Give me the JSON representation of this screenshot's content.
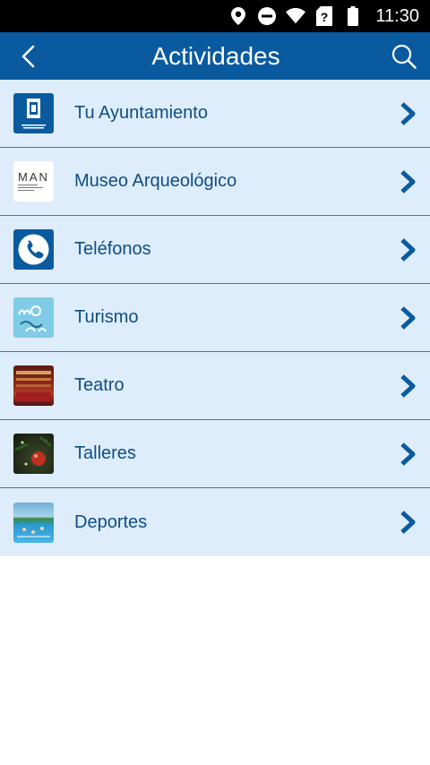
{
  "status_bar": {
    "time": "11:30",
    "icons": [
      "location-icon",
      "do-not-disturb-icon",
      "wifi-icon",
      "no-sim-icon",
      "battery-icon"
    ]
  },
  "app_bar": {
    "title": "Actividades",
    "back_icon": "back-chevron-icon",
    "search_icon": "search-icon"
  },
  "items": [
    {
      "label": "Tu Ayuntamiento",
      "thumb": "madrid-logo"
    },
    {
      "label": "Museo Arqueológico",
      "thumb": "man-museum-logo",
      "thumb_text": "MAN"
    },
    {
      "label": "Teléfonos",
      "thumb": "phone"
    },
    {
      "label": "Turismo",
      "thumb": "madrid-tourism-logo"
    },
    {
      "label": "Teatro",
      "thumb": "theatre-photo"
    },
    {
      "label": "Talleres",
      "thumb": "workshops-photo"
    },
    {
      "label": "Deportes",
      "thumb": "sports-photo"
    }
  ],
  "colors": {
    "app_bar": "#0a5aa0",
    "row_bg": "#deedfb",
    "divider": "#3f78a8",
    "label": "#0e4d86",
    "chevron": "#0b5a9e"
  }
}
